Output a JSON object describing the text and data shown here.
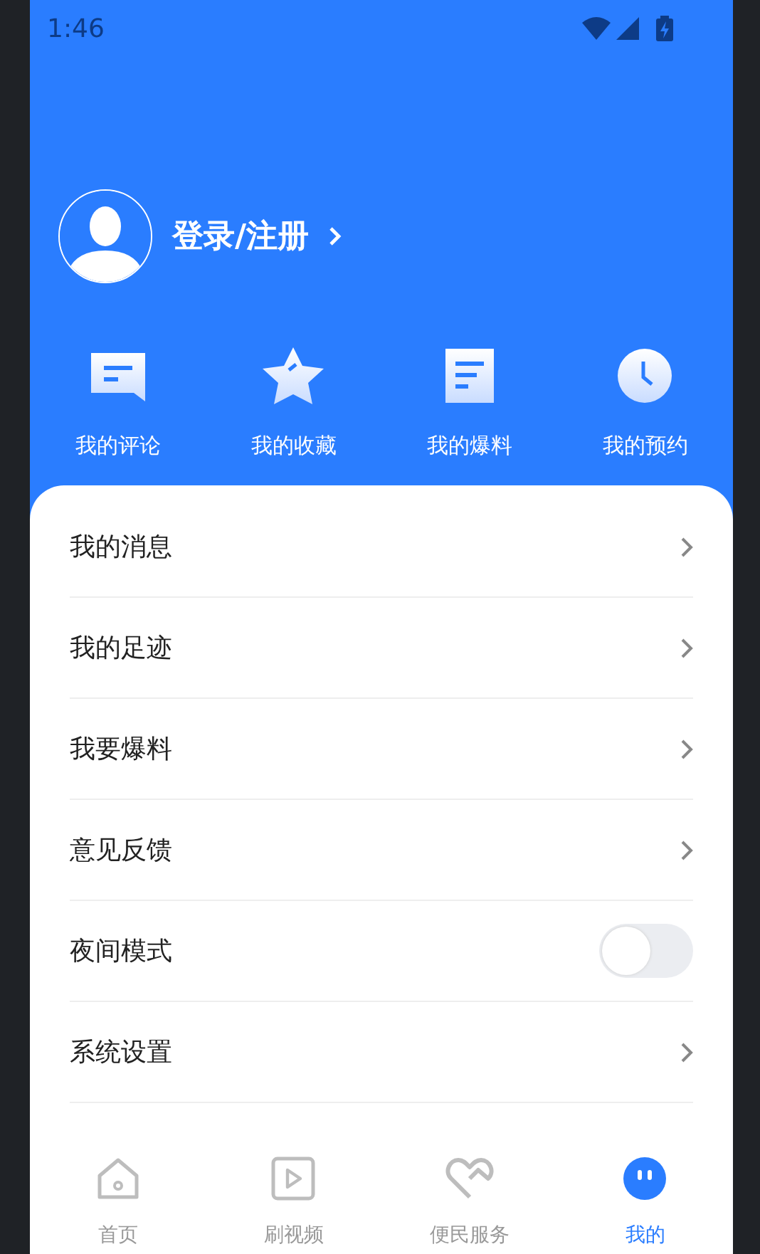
{
  "status_bar": {
    "time": "1:46"
  },
  "profile": {
    "login_label": "登录/注册"
  },
  "quick_actions": [
    {
      "kind": "comment",
      "label": "我的评论"
    },
    {
      "kind": "star",
      "label": "我的收藏"
    },
    {
      "kind": "document",
      "label": "我的爆料"
    },
    {
      "kind": "clock",
      "label": "我的预约"
    }
  ],
  "menu": [
    {
      "kind": "link",
      "label": "我的消息"
    },
    {
      "kind": "link",
      "label": "我的足迹"
    },
    {
      "kind": "link",
      "label": "我要爆料"
    },
    {
      "kind": "link",
      "label": "意见反馈"
    },
    {
      "kind": "toggle",
      "label": "夜间模式",
      "on": false
    },
    {
      "kind": "link",
      "label": "系统设置"
    }
  ],
  "bottom_nav": [
    {
      "kind": "home",
      "label": "首页",
      "selected": false
    },
    {
      "kind": "video",
      "label": "刷视频",
      "selected": false
    },
    {
      "kind": "heart",
      "label": "便民服务",
      "selected": false
    },
    {
      "kind": "face",
      "label": "我的",
      "selected": true
    }
  ]
}
